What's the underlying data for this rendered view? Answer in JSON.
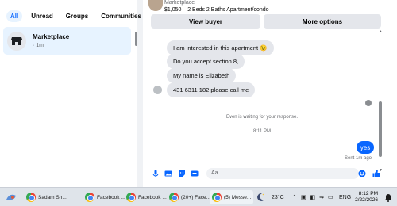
{
  "sidebar": {
    "tabs": [
      "All",
      "Unread",
      "Groups",
      "Communities"
    ],
    "conversation": {
      "name": "Marketplace",
      "time": "· 1m"
    }
  },
  "chat": {
    "header": {
      "title": "Marketplace",
      "subtitle": "$1,050 – 2 Beds 2 Baths Apartment/condo"
    },
    "buttons": {
      "view_buyer": "View buyer",
      "more_options": "More options"
    },
    "messages": [
      "I am interested in this apartment 😉",
      "Do you accept section 8,",
      "My name is Elizabeth",
      "431 6311 182 please call me"
    ],
    "waiting": "Even is waiting for your response.",
    "timestamp": "8:11 PM",
    "my_message": "yes",
    "sent_status": "Sent 1m ago",
    "composer_placeholder": "Aa"
  },
  "taskbar": {
    "items": [
      "Sadam Sh...",
      "Facebook ...",
      "Facebook ...",
      "(20+) Face...",
      "(5) Messe..."
    ],
    "temperature": "23°C",
    "language": "ENG",
    "time": "8:12 PM",
    "date": "2/22/2026"
  },
  "colors": {
    "accent": "#0866ff",
    "bubble_gray": "#e4e6eb",
    "active_bg": "#e7f3ff"
  }
}
